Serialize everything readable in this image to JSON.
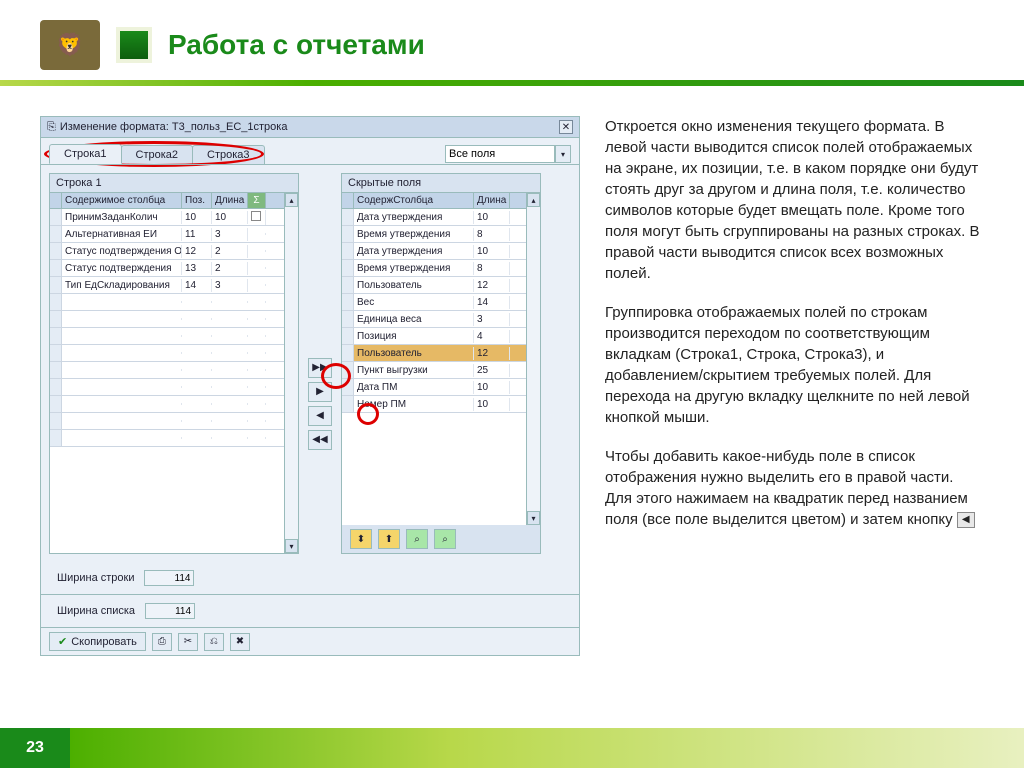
{
  "page": {
    "title": "Работа с отчетами",
    "number": "23"
  },
  "window": {
    "title": "Изменение формата: Т3_польз_ЕС_1строка",
    "tabs": [
      "Строка1",
      "Строка2",
      "Строка3"
    ],
    "all_fields_label": "Все поля"
  },
  "left": {
    "title": "Строка 1",
    "headers": {
      "col1": "Содержимое столбца",
      "col2": "Поз.",
      "col3": "Длина",
      "col4": "Σ"
    },
    "rows": [
      {
        "name": "ПринимЗаданКолич",
        "pos": "10",
        "len": "10"
      },
      {
        "name": "Альтернативная ЕИ",
        "pos": "11",
        "len": "3"
      },
      {
        "name": "Статус подтверждения Отг",
        "pos": "12",
        "len": "2"
      },
      {
        "name": "Статус подтверждения",
        "pos": "13",
        "len": "2"
      },
      {
        "name": "Тип ЕдСкладирования",
        "pos": "14",
        "len": "3"
      }
    ],
    "width_row_label": "Ширина строки",
    "width_row_val": "114",
    "width_list_label": "Ширина списка",
    "width_list_val": "114"
  },
  "right": {
    "title": "Скрытые поля",
    "headers": {
      "col1": "СодержСтолбца",
      "col2": "Длина"
    },
    "rows": [
      {
        "name": "Дата утверждения",
        "len": "10",
        "sel": false
      },
      {
        "name": "Время утверждения",
        "len": "8",
        "sel": false
      },
      {
        "name": "Дата утверждения",
        "len": "10",
        "sel": false
      },
      {
        "name": "Время утверждения",
        "len": "8",
        "sel": false
      },
      {
        "name": "Пользователь",
        "len": "12",
        "sel": false
      },
      {
        "name": "Вес",
        "len": "14",
        "sel": false
      },
      {
        "name": "Единица веса",
        "len": "3",
        "sel": false
      },
      {
        "name": "Позиция",
        "len": "4",
        "sel": false
      },
      {
        "name": "Пользователь",
        "len": "12",
        "sel": true
      },
      {
        "name": "Пункт выгрузки",
        "len": "25",
        "sel": false
      },
      {
        "name": "Дата ПМ",
        "len": "10",
        "sel": false
      },
      {
        "name": "Номер ПМ",
        "len": "10",
        "sel": false
      }
    ]
  },
  "buttons": {
    "copy": "Скопировать"
  },
  "explain": {
    "p1": "Откроется окно изменения текущего формата. В левой части выводится список полей отображаемых на экране, их позиции, т.е. в каком порядке они будут стоять друг за другом и длина поля, т.е. количество символов которые будет вмещать поле. Кроме того поля могут быть сгруппированы на разных строках. В правой части выводится список всех возможных полей.",
    "p2": "Группировка отображаемых полей по строкам производится переходом по соответствующим вкладкам (Строка1, Строка, Строка3), и добавлением/скрытием требуемых полей. Для перехода на другую вкладку щелкните по ней левой кнопкой мыши.",
    "p3a": "Чтобы добавить какое-нибудь поле в список отображения нужно выделить его в правой части. Для этого нажимаем на квадратик перед названием поля (все поле выделится цветом) и затем кнопку",
    "p3_icon": "◀"
  }
}
